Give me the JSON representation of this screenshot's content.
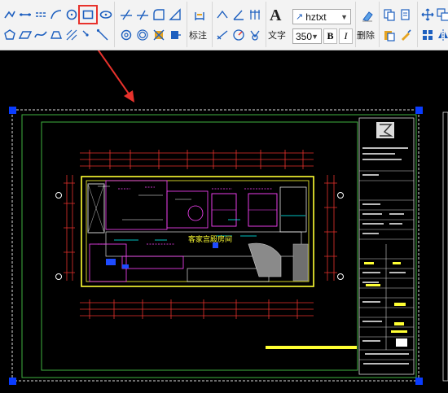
{
  "toolbar": {
    "annotate_label": "标注",
    "text_label": "文字",
    "delete_label": "删除",
    "font_name": "hztxt",
    "font_size": "350",
    "bold_label": "B",
    "italic_label": "I",
    "text_glyph": "A",
    "font_style_glyph": "↗"
  },
  "drawing": {
    "room_label": "客家宫殿房间"
  },
  "colors": {
    "highlight": "#e8322c",
    "grip": "#0a3cff",
    "canvas_bg": "#000000",
    "frame": "#3fb23f",
    "plan": "#ffff33"
  }
}
